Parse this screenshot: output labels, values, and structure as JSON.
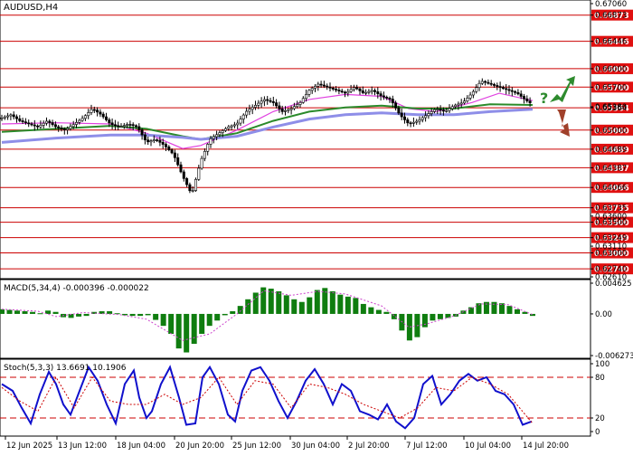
{
  "chart_data": {
    "type": "candlestick",
    "symbol": "AUDUSD,H4",
    "main": {
      "ylim": [
        0.6261,
        0.6706
      ],
      "y_ticks": [
        "0.67060",
        "0.66873",
        "0.66446",
        "0.66000",
        "0.65700",
        "0.65380",
        "0.65364",
        "0.65000",
        "0.64689",
        "0.64387",
        "0.64066",
        "0.63735",
        "0.63600",
        "0.63500",
        "0.63249",
        "0.63110",
        "0.63000",
        "0.62740",
        "0.62610"
      ],
      "levels": [
        {
          "label": "0.66873",
          "value": 0.66873
        },
        {
          "label": "0.66446",
          "value": 0.66446
        },
        {
          "label": "0.66000",
          "value": 0.66
        },
        {
          "label": "0.65700",
          "value": 0.657
        },
        {
          "label": "0.65364",
          "value": 0.65364
        },
        {
          "label": "0.65000",
          "value": 0.65
        },
        {
          "label": "0.64689",
          "value": 0.64689
        },
        {
          "label": "0.64387",
          "value": 0.64387
        },
        {
          "label": "0.64066",
          "value": 0.64066
        },
        {
          "label": "0.63735",
          "value": 0.63735
        },
        {
          "label": "0.63500",
          "value": 0.635
        },
        {
          "label": "0.63249",
          "value": 0.63249
        },
        {
          "label": "0.63000",
          "value": 0.63
        },
        {
          "label": "0.62740",
          "value": 0.6274
        }
      ],
      "price_curve": [
        [
          0,
          0.652
        ],
        [
          10,
          0.6525
        ],
        [
          20,
          0.6515
        ],
        [
          30,
          0.651
        ],
        [
          40,
          0.6505
        ],
        [
          50,
          0.6515
        ],
        [
          60,
          0.6505
        ],
        [
          70,
          0.65
        ],
        [
          80,
          0.651
        ],
        [
          90,
          0.652
        ],
        [
          100,
          0.6535
        ],
        [
          110,
          0.6525
        ],
        [
          120,
          0.651
        ],
        [
          130,
          0.6505
        ],
        [
          140,
          0.651
        ],
        [
          150,
          0.6505
        ],
        [
          160,
          0.648
        ],
        [
          170,
          0.6485
        ],
        [
          180,
          0.6475
        ],
        [
          190,
          0.646
        ],
        [
          200,
          0.6425
        ],
        [
          210,
          0.6395
        ],
        [
          220,
          0.645
        ],
        [
          230,
          0.6485
        ],
        [
          240,
          0.6495
        ],
        [
          250,
          0.6505
        ],
        [
          260,
          0.651
        ],
        [
          270,
          0.653
        ],
        [
          280,
          0.654
        ],
        [
          290,
          0.655
        ],
        [
          300,
          0.6545
        ],
        [
          310,
          0.653
        ],
        [
          320,
          0.6535
        ],
        [
          330,
          0.6545
        ],
        [
          340,
          0.6565
        ],
        [
          350,
          0.6575
        ],
        [
          360,
          0.657
        ],
        [
          370,
          0.6565
        ],
        [
          380,
          0.656
        ],
        [
          390,
          0.657
        ],
        [
          400,
          0.656
        ],
        [
          410,
          0.6565
        ],
        [
          420,
          0.6555
        ],
        [
          430,
          0.655
        ],
        [
          440,
          0.6525
        ],
        [
          450,
          0.651
        ],
        [
          460,
          0.6515
        ],
        [
          470,
          0.6525
        ],
        [
          480,
          0.6535
        ],
        [
          490,
          0.653
        ],
        [
          500,
          0.654
        ],
        [
          510,
          0.6545
        ],
        [
          520,
          0.656
        ],
        [
          530,
          0.658
        ],
        [
          540,
          0.6575
        ],
        [
          550,
          0.657
        ],
        [
          560,
          0.6565
        ],
        [
          570,
          0.656
        ],
        [
          580,
          0.6548
        ],
        [
          587,
          0.6542
        ]
      ],
      "ma_series": [
        {
          "color": "#e040e0",
          "points": [
            [
              0,
              0.651
            ],
            [
              60,
              0.6512
            ],
            [
              120,
              0.651
            ],
            [
              160,
              0.6495
            ],
            [
              200,
              0.647
            ],
            [
              220,
              0.6475
            ],
            [
              260,
              0.65
            ],
            [
              300,
              0.653
            ],
            [
              340,
              0.655
            ],
            [
              380,
              0.6558
            ],
            [
              420,
              0.6555
            ],
            [
              450,
              0.6535
            ],
            [
              480,
              0.653
            ],
            [
              520,
              0.6545
            ],
            [
              550,
              0.656
            ],
            [
              587,
              0.6548
            ]
          ]
        },
        {
          "color": "#2a8a2a",
          "points": [
            [
              0,
              0.6497
            ],
            [
              60,
              0.6502
            ],
            [
              120,
              0.6507
            ],
            [
              160,
              0.6502
            ],
            [
              200,
              0.649
            ],
            [
              220,
              0.6485
            ],
            [
              260,
              0.6495
            ],
            [
              300,
              0.6515
            ],
            [
              340,
              0.653
            ],
            [
              380,
              0.6537
            ],
            [
              420,
              0.654
            ],
            [
              460,
              0.6535
            ],
            [
              500,
              0.6535
            ],
            [
              540,
              0.6542
            ],
            [
              587,
              0.6541
            ]
          ]
        },
        {
          "color": "#8e8ee8",
          "points": [
            [
              0,
              0.648
            ],
            [
              60,
              0.6487
            ],
            [
              120,
              0.6492
            ],
            [
              160,
              0.6492
            ],
            [
              200,
              0.6488
            ],
            [
              220,
              0.6485
            ],
            [
              260,
              0.649
            ],
            [
              300,
              0.6505
            ],
            [
              340,
              0.6518
            ],
            [
              380,
              0.6525
            ],
            [
              420,
              0.6528
            ],
            [
              460,
              0.6525
            ],
            [
              500,
              0.6525
            ],
            [
              540,
              0.653
            ],
            [
              587,
              0.6534
            ]
          ]
        }
      ]
    },
    "macd": {
      "label": "MACD(5,34,4) -0.000396 -0.000022",
      "ylim": [
        -0.006273,
        0.004625
      ],
      "y_ticks": [
        "0.004625",
        "0.00",
        "-0.006273"
      ],
      "histogram": [
        0.0007,
        0.0006,
        0.0005,
        0.0004,
        0.0003,
        0.0001,
        0.0005,
        0.0003,
        -0.0005,
        -0.0006,
        -0.0004,
        -0.0003,
        0.0003,
        0.0004,
        0.0004,
        0.0001,
        -0.0002,
        -0.0003,
        -0.0003,
        -0.0002,
        -0.0009,
        -0.0018,
        -0.003,
        -0.0052,
        -0.0058,
        -0.0045,
        -0.003,
        -0.0018,
        -0.001,
        -0.0002,
        0.0004,
        0.0012,
        0.0022,
        0.0032,
        0.004,
        0.0038,
        0.0034,
        0.0028,
        0.0022,
        0.0018,
        0.0025,
        0.0036,
        0.0039,
        0.0034,
        0.0029,
        0.0026,
        0.0024,
        0.0015,
        0.001,
        0.0006,
        0.0003,
        -0.0008,
        -0.0025,
        -0.004,
        -0.0035,
        -0.002,
        -0.001,
        -0.0008,
        -0.0006,
        -0.0004,
        0.0005,
        0.001,
        0.0016,
        0.0018,
        0.0018,
        0.0016,
        0.0012,
        0.0007,
        0.0003,
        -0.0003
      ],
      "signal": [
        [
          0,
          0.0007
        ],
        [
          40,
          0.0004
        ],
        [
          60,
          -0.0004
        ],
        [
          90,
          0.0002
        ],
        [
          130,
          -0.0001
        ],
        [
          160,
          -0.0008
        ],
        [
          200,
          -0.004
        ],
        [
          230,
          -0.003
        ],
        [
          260,
          0.0
        ],
        [
          290,
          0.0035
        ],
        [
          320,
          0.0028
        ],
        [
          350,
          0.0034
        ],
        [
          380,
          0.003
        ],
        [
          420,
          0.0012
        ],
        [
          450,
          -0.002
        ],
        [
          470,
          -0.0015
        ],
        [
          500,
          -0.0003
        ],
        [
          530,
          0.0015
        ],
        [
          560,
          0.0014
        ],
        [
          587,
          -0.0001
        ]
      ]
    },
    "stoch": {
      "label": "Stoch(5,3,3) 13.6691 10.1906",
      "ylim": [
        0,
        100
      ],
      "y_ticks": [
        "100",
        "80",
        "20",
        "0"
      ],
      "levels": [
        80,
        20
      ],
      "main_line": [
        [
          0,
          70
        ],
        [
          12,
          60
        ],
        [
          22,
          35
        ],
        [
          32,
          12
        ],
        [
          42,
          55
        ],
        [
          52,
          88
        ],
        [
          60,
          70
        ],
        [
          68,
          40
        ],
        [
          76,
          25
        ],
        [
          86,
          60
        ],
        [
          96,
          95
        ],
        [
          106,
          75
        ],
        [
          116,
          40
        ],
        [
          126,
          12
        ],
        [
          136,
          70
        ],
        [
          146,
          90
        ],
        [
          152,
          50
        ],
        [
          160,
          20
        ],
        [
          166,
          30
        ],
        [
          176,
          70
        ],
        [
          186,
          95
        ],
        [
          196,
          50
        ],
        [
          204,
          10
        ],
        [
          214,
          12
        ],
        [
          222,
          80
        ],
        [
          230,
          95
        ],
        [
          240,
          70
        ],
        [
          250,
          25
        ],
        [
          258,
          15
        ],
        [
          266,
          60
        ],
        [
          276,
          90
        ],
        [
          286,
          95
        ],
        [
          296,
          75
        ],
        [
          306,
          45
        ],
        [
          316,
          20
        ],
        [
          326,
          45
        ],
        [
          336,
          75
        ],
        [
          346,
          92
        ],
        [
          356,
          70
        ],
        [
          366,
          40
        ],
        [
          376,
          70
        ],
        [
          386,
          60
        ],
        [
          396,
          30
        ],
        [
          406,
          25
        ],
        [
          416,
          18
        ],
        [
          426,
          40
        ],
        [
          436,
          15
        ],
        [
          446,
          5
        ],
        [
          456,
          20
        ],
        [
          466,
          70
        ],
        [
          476,
          82
        ],
        [
          486,
          40
        ],
        [
          496,
          55
        ],
        [
          506,
          75
        ],
        [
          516,
          85
        ],
        [
          526,
          75
        ],
        [
          536,
          80
        ],
        [
          546,
          60
        ],
        [
          556,
          55
        ],
        [
          566,
          40
        ],
        [
          576,
          10
        ],
        [
          586,
          15
        ]
      ],
      "signal_line": [
        [
          0,
          65
        ],
        [
          20,
          45
        ],
        [
          40,
          30
        ],
        [
          60,
          80
        ],
        [
          80,
          35
        ],
        [
          100,
          80
        ],
        [
          120,
          45
        ],
        [
          140,
          40
        ],
        [
          160,
          40
        ],
        [
          180,
          55
        ],
        [
          200,
          40
        ],
        [
          220,
          50
        ],
        [
          240,
          80
        ],
        [
          260,
          40
        ],
        [
          280,
          75
        ],
        [
          300,
          70
        ],
        [
          320,
          35
        ],
        [
          340,
          70
        ],
        [
          360,
          65
        ],
        [
          380,
          55
        ],
        [
          400,
          40
        ],
        [
          420,
          30
        ],
        [
          440,
          20
        ],
        [
          460,
          35
        ],
        [
          480,
          65
        ],
        [
          500,
          60
        ],
        [
          520,
          80
        ],
        [
          540,
          70
        ],
        [
          560,
          55
        ],
        [
          587,
          12
        ]
      ]
    },
    "x_ticks": [
      "12 Jun 2025",
      "13 Jun 12:00",
      "18 Jun 04:00",
      "20 Jun 20:00",
      "25 Jun 12:00",
      "30 Jun 04:00",
      "2 Jul 20:00",
      "7 Jul 12:00",
      "10 Jul 04:00",
      "14 Jul 20:00"
    ],
    "annotation": {
      "text": "?",
      "up_color": "#2e8b2e",
      "down_color": "#a0402a"
    },
    "colors": {
      "level_line": "#cc0000",
      "level_label_bg": "#e01010",
      "level_label_text": "#ffffff",
      "bar_up": "#000000",
      "histogram": "#0f7d0f",
      "macd_signal": "#cc44cc",
      "stoch_main": "#1010cc",
      "stoch_signal": "#cc0000",
      "stoch_level": "#cc0000"
    }
  }
}
